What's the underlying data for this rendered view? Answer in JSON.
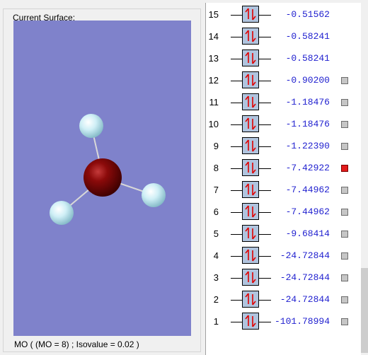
{
  "surface_panel": {
    "legend": "Current Surface:",
    "caption": "MO ( (MO = 8) ; Isovalue = 0.02 )",
    "background_color": "#7f82cb",
    "central_atom_color": "#8b0a0a",
    "hydrogen_color": "#cfeff6"
  },
  "mo_list": {
    "selected_color": "#e21b1b",
    "energy_color": "#1f1fcf",
    "orbitals": [
      {
        "index": "15",
        "energy": "-0.51562",
        "occupancy": "up-down",
        "has_checkbox": false,
        "selected": false
      },
      {
        "index": "14",
        "energy": "-0.58241",
        "occupancy": "up-down",
        "has_checkbox": false,
        "selected": false
      },
      {
        "index": "13",
        "energy": "-0.58241",
        "occupancy": "up-down",
        "has_checkbox": false,
        "selected": false
      },
      {
        "index": "12",
        "energy": "-0.90200",
        "occupancy": "up-down",
        "has_checkbox": true,
        "selected": false
      },
      {
        "index": "11",
        "energy": "-1.18476",
        "occupancy": "up-down",
        "has_checkbox": true,
        "selected": false
      },
      {
        "index": "10",
        "energy": "-1.18476",
        "occupancy": "up-down",
        "has_checkbox": true,
        "selected": false
      },
      {
        "index": "9",
        "energy": "-1.22390",
        "occupancy": "up-down",
        "has_checkbox": true,
        "selected": false
      },
      {
        "index": "8",
        "energy": "-7.42922",
        "occupancy": "up-down",
        "has_checkbox": true,
        "selected": true
      },
      {
        "index": "7",
        "energy": "-7.44962",
        "occupancy": "up-down",
        "has_checkbox": true,
        "selected": false
      },
      {
        "index": "6",
        "energy": "-7.44962",
        "occupancy": "up-down",
        "has_checkbox": true,
        "selected": false
      },
      {
        "index": "5",
        "energy": "-9.68414",
        "occupancy": "up-down",
        "has_checkbox": true,
        "selected": false
      },
      {
        "index": "4",
        "energy": "-24.72844",
        "occupancy": "up-down",
        "has_checkbox": true,
        "selected": false
      },
      {
        "index": "3",
        "energy": "-24.72844",
        "occupancy": "up-down",
        "has_checkbox": true,
        "selected": false
      },
      {
        "index": "2",
        "energy": "-24.72844",
        "occupancy": "up-down",
        "has_checkbox": true,
        "selected": false
      },
      {
        "index": "1",
        "energy": "-101.78994",
        "occupancy": "up-down",
        "has_checkbox": true,
        "selected": false
      }
    ]
  }
}
